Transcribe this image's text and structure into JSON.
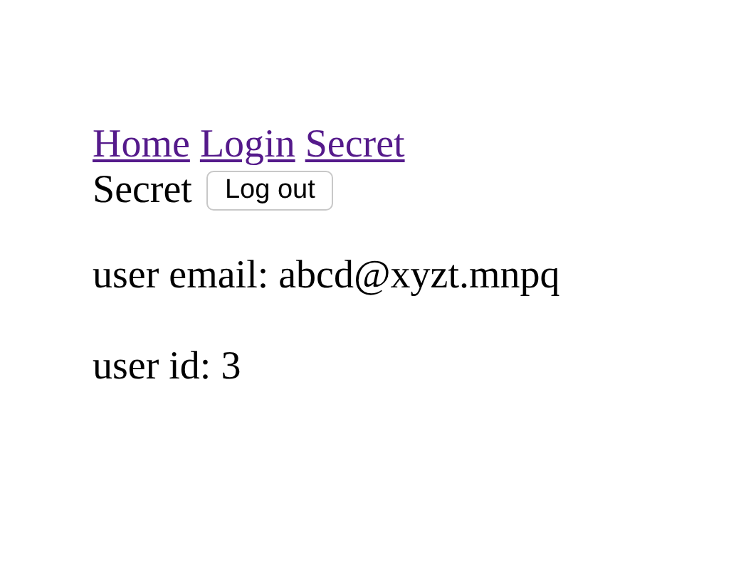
{
  "nav_links": [
    {
      "label": "Home"
    },
    {
      "label": "Login"
    },
    {
      "label": "Secret"
    }
  ],
  "page_title": "Secret",
  "logout_button": "Log out",
  "lines": [
    "user email: abcd@xyzt.mnpq",
    "user id: 3"
  ]
}
